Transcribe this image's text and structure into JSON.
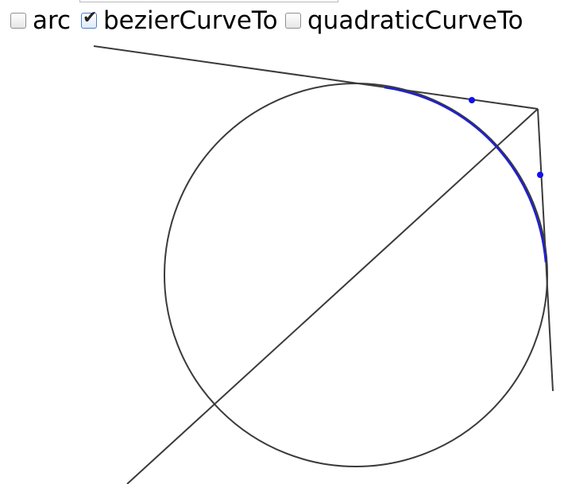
{
  "controls": {
    "options": [
      {
        "label": "arc",
        "checked": false
      },
      {
        "label": "bezierCurveTo",
        "checked": true
      },
      {
        "label": "quadraticCurveTo",
        "checked": false
      }
    ]
  },
  "colors": {
    "lines": "#3a3a3a",
    "curve": "#1f1fd6",
    "control_point": "#1010ee"
  }
}
